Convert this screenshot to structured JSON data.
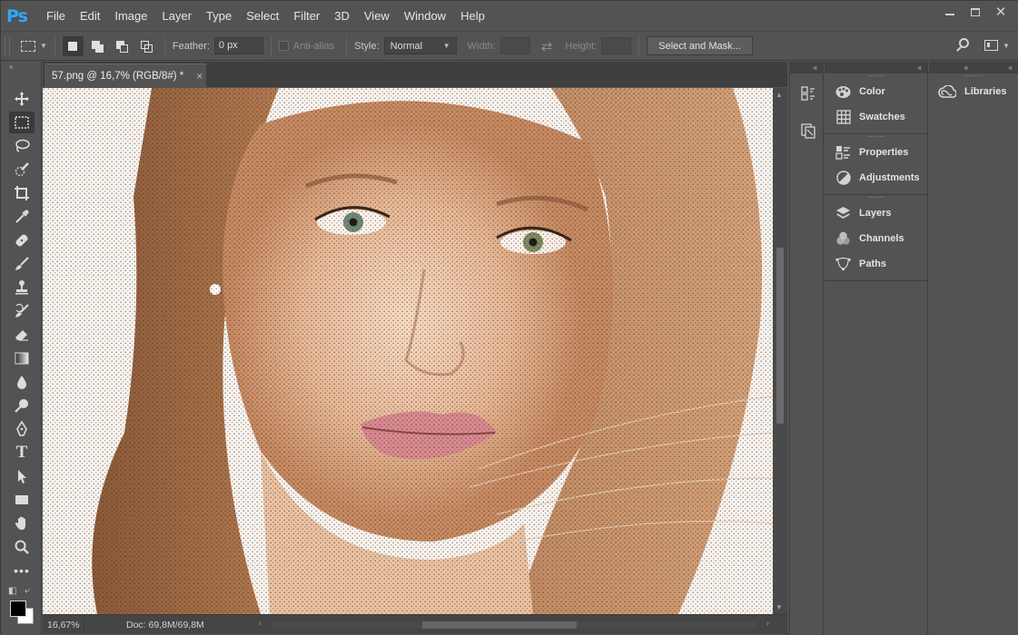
{
  "app": {
    "logo": "Ps",
    "accent": "#31a8ff"
  },
  "menu": [
    "File",
    "Edit",
    "Image",
    "Layer",
    "Type",
    "Select",
    "Filter",
    "3D",
    "View",
    "Window",
    "Help"
  ],
  "window_controls": [
    "minimize",
    "maximize",
    "close"
  ],
  "options_bar": {
    "feather_label": "Feather:",
    "feather_value": "0 px",
    "antialias_label": "Anti-alias",
    "style_label": "Style:",
    "style_value": "Normal",
    "width_label": "Width:",
    "width_value": "",
    "height_label": "Height:",
    "height_value": "",
    "select_mask_label": "Select and Mask..."
  },
  "document": {
    "tab_title": "57.png @ 16,7% (RGB/8#) *",
    "tab_close": "×"
  },
  "status": {
    "zoom": "16,67%",
    "doc_info": "Doc: 69,8M/69,8M",
    "arrow": "›"
  },
  "tools": [
    "move-tool",
    "rectangular-marquee-tool",
    "lasso-tool",
    "quick-selection-tool",
    "crop-tool",
    "eyedropper-tool",
    "spot-healing-brush-tool",
    "brush-tool",
    "clone-stamp-tool",
    "history-brush-tool",
    "eraser-tool",
    "gradient-tool",
    "blur-tool",
    "dodge-tool",
    "pen-tool",
    "type-tool",
    "path-selection-tool",
    "rectangle-tool",
    "hand-tool",
    "zoom-tool",
    "edit-toolbar"
  ],
  "colors": {
    "foreground": "#000000",
    "background": "#ffffff"
  },
  "panels": {
    "group1": [
      "Color",
      "Swatches"
    ],
    "group2": [
      "Properties",
      "Adjustments"
    ],
    "group3": [
      "Layers",
      "Channels",
      "Paths"
    ],
    "libraries": "Libraries"
  }
}
